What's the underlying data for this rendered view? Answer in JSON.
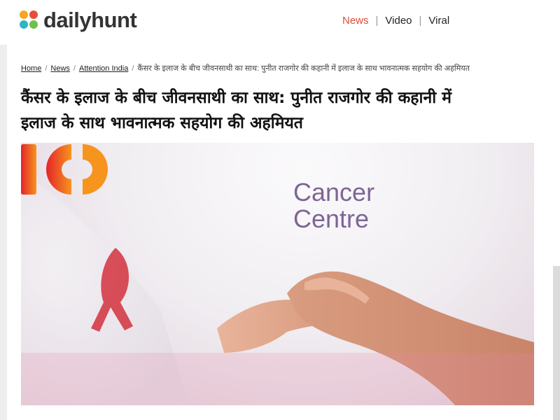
{
  "header": {
    "logo_text": "dailyhunt",
    "logo_colors": [
      "#f5a623",
      "#e94b3c",
      "#2bb5c8",
      "#6cc24a"
    ],
    "nav": [
      {
        "label": "News",
        "active": true
      },
      {
        "label": "Video",
        "active": false
      },
      {
        "label": "Viral",
        "active": false
      }
    ],
    "nav_separator": "|"
  },
  "breadcrumb": {
    "items": [
      "Home",
      "News",
      "Attention India"
    ],
    "current": "कैंसर के इलाज के बीच जीवनसाथी का साथ: पुनीत राजगोर की कहानी में इलाज के साथ भावनात्मक सहयोग की अहमियत",
    "separator": "/"
  },
  "article": {
    "title_line1": "कैंसर के इलाज के बीच जीवनसाथी का साथ: पुनीत राजगोर की कहानी में",
    "title_line2": "इलाज के साथ भावनात्मक सहयोग की अहमियत"
  },
  "hero": {
    "brand_line1": "Cancer",
    "brand_line2": "Centre",
    "brand_color": "#7d6596",
    "logo_gradient": [
      "#e3242b",
      "#f7941d"
    ]
  }
}
